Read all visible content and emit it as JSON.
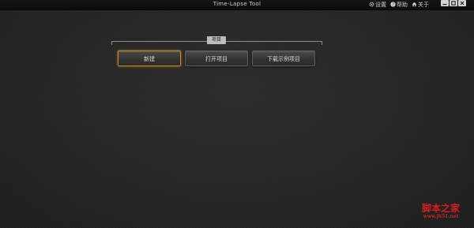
{
  "window": {
    "title": "Time-Lapse Tool",
    "links": [
      {
        "icon": "gear-icon",
        "label": "设置"
      },
      {
        "icon": "help-icon",
        "label": "帮助"
      },
      {
        "icon": "home-icon",
        "label": "关于"
      }
    ],
    "controls": [
      "minimize-icon",
      "maximize-icon",
      "close-icon"
    ]
  },
  "project": {
    "section_label": "项目",
    "buttons": [
      {
        "label": "新建",
        "selected": true
      },
      {
        "label": "打开项目",
        "selected": false
      },
      {
        "label": "下载示例项目",
        "selected": false
      }
    ]
  },
  "watermark": {
    "name": "脚本之家",
    "url": "www.jb51.net"
  },
  "colors": {
    "background": "#262626",
    "accent": "#c08a25",
    "watermark": "#d02020"
  }
}
